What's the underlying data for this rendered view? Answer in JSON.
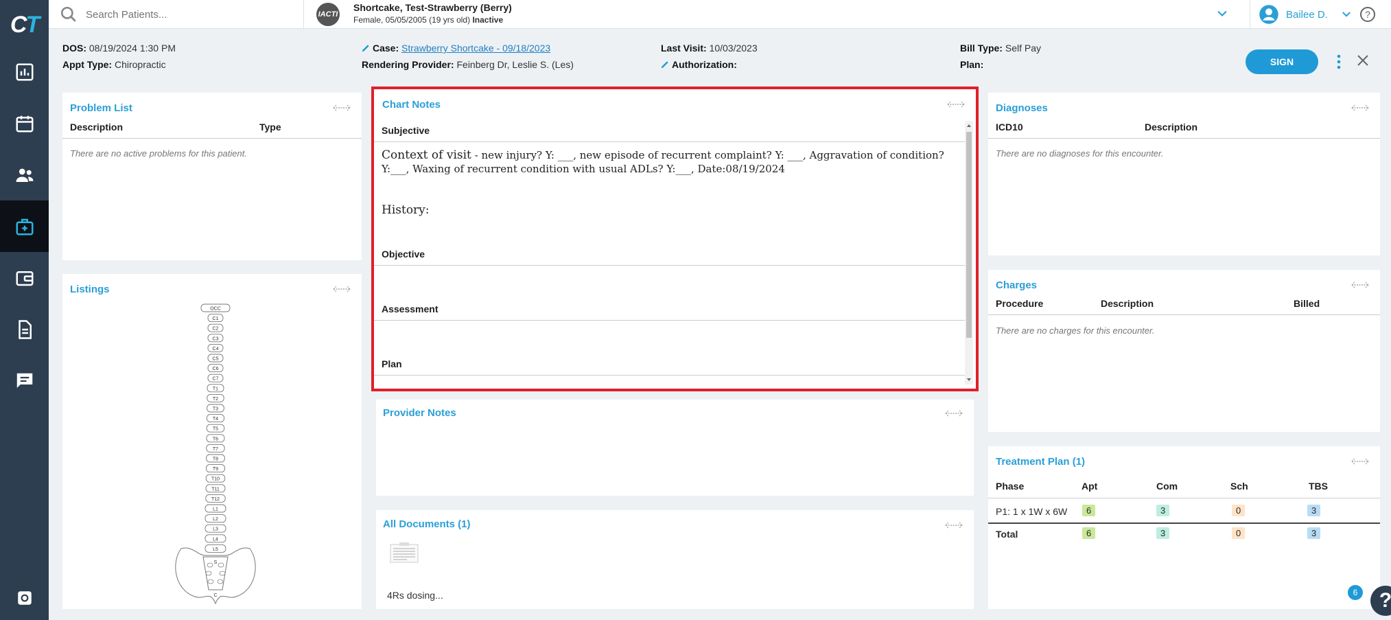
{
  "sidebar": {
    "logo_c": "C",
    "logo_t": "T",
    "items": [
      {
        "name": "dashboard"
      },
      {
        "name": "calendar"
      },
      {
        "name": "patients"
      },
      {
        "name": "encounter",
        "active": true
      },
      {
        "name": "billing"
      },
      {
        "name": "documents"
      },
      {
        "name": "messages"
      },
      {
        "name": "settings"
      }
    ]
  },
  "topbar": {
    "search_placeholder": "Search Patients...",
    "patient_avatar_text": "IACTI",
    "patient_name": "Shortcake, Test-Strawberry (Berry)",
    "patient_details": "Female, 05/05/2005 (19 yrs old)",
    "patient_status": "Inactive",
    "user_name": "Bailee D."
  },
  "encounter": {
    "dos_label": "DOS:",
    "dos_value": "08/19/2024 1:30 PM",
    "appt_label": "Appt Type:",
    "appt_value": "Chiropractic",
    "case_label": "Case:",
    "case_value": "Strawberry Shortcake - 09/18/2023",
    "provider_label": "Rendering Provider:",
    "provider_value": "Feinberg Dr, Leslie S. (Les)",
    "last_visit_label": "Last Visit:",
    "last_visit_value": "10/03/2023",
    "auth_label": "Authorization:",
    "bill_type_label": "Bill Type:",
    "bill_type_value": "Self Pay",
    "plan_label": "Plan:",
    "sign_label": "SIGN"
  },
  "problem_list": {
    "title": "Problem List",
    "col_description": "Description",
    "col_type": "Type",
    "empty": "There are no active problems for this patient."
  },
  "listings": {
    "title": "Listings",
    "vertebrae": [
      "OCC",
      "C1",
      "C2",
      "C3",
      "C4",
      "C5",
      "C6",
      "C7",
      "T1",
      "T2",
      "T3",
      "T4",
      "T5",
      "T6",
      "T7",
      "T8",
      "T9",
      "T10",
      "T11",
      "T12",
      "L1",
      "L2",
      "L3",
      "L4",
      "L5"
    ],
    "sacrum_label": "S",
    "coccyx_label": "C"
  },
  "chart_notes": {
    "title": "Chart Notes",
    "subjective": "Subjective",
    "context_label": "Context of visit",
    "context_text": " - new injury? Y: ___, new episode of recurrent complaint? Y: ___, Aggravation of condition? Y:___, Waxing of recurrent condition with usual ADLs? Y:___, Date:08/19/2024",
    "history_label": "History:",
    "objective": "Objective",
    "assessment": "Assessment",
    "plan": "Plan"
  },
  "provider_notes": {
    "title": "Provider Notes"
  },
  "all_documents": {
    "title": "All Documents (1)",
    "doc_name": "4Rs dosing..."
  },
  "diagnoses": {
    "title": "Diagnoses",
    "col_icd": "ICD10",
    "col_description": "Description",
    "empty": "There are no diagnoses for this encounter."
  },
  "charges": {
    "title": "Charges",
    "col_procedure": "Procedure",
    "col_description": "Description",
    "col_billed": "Billed",
    "empty": "There are no charges for this encounter."
  },
  "treatment_plan": {
    "title": "Treatment Plan (1)",
    "col_phase": "Phase",
    "col_apt": "Apt",
    "col_com": "Com",
    "col_sch": "Sch",
    "col_tbs": "TBS",
    "row_phase": "P1: 1 x 1W x 6W",
    "row_apt": "6",
    "row_com": "3",
    "row_sch": "0",
    "row_tbs": "3",
    "total_label": "Total",
    "total_apt": "6",
    "total_com": "3",
    "total_sch": "0",
    "total_tbs": "3"
  },
  "help": {
    "count": "6",
    "glyph": "?"
  },
  "colors": {
    "accent": "#2a9fd6",
    "sidebar": "#2c3e50",
    "highlight": "#e0202a"
  }
}
